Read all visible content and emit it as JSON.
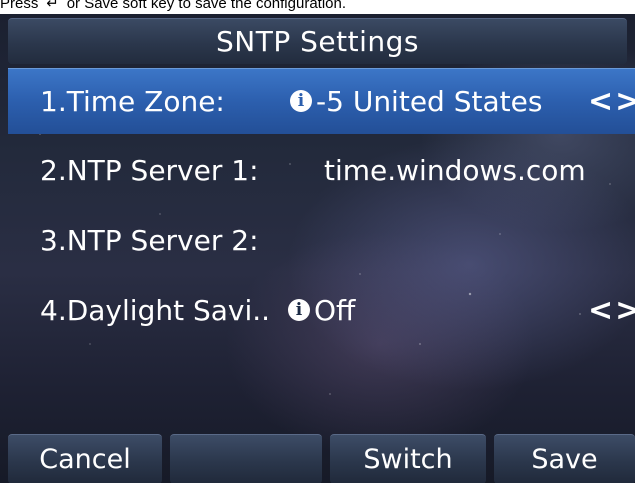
{
  "instruction": {
    "prefix": "Press",
    "icon": "ok-key-icon",
    "suffix": "or Save soft key to save the configuration."
  },
  "screen": {
    "title": "SNTP Settings",
    "rows": [
      {
        "label": "1.Time Zone:",
        "value": "-5 United States",
        "info": true,
        "arrows": true
      },
      {
        "label": "2.NTP Server 1:",
        "value": "time.windows.com"
      },
      {
        "label": "3.NTP Server 2:",
        "value": ""
      },
      {
        "label": "4.Daylight Savi..",
        "value": "Off",
        "info": true,
        "arrows": true
      }
    ],
    "arrow_glyph": "<>"
  },
  "softkeys": {
    "cancel": "Cancel",
    "blank": "",
    "switch": "Switch",
    "save": "Save"
  }
}
